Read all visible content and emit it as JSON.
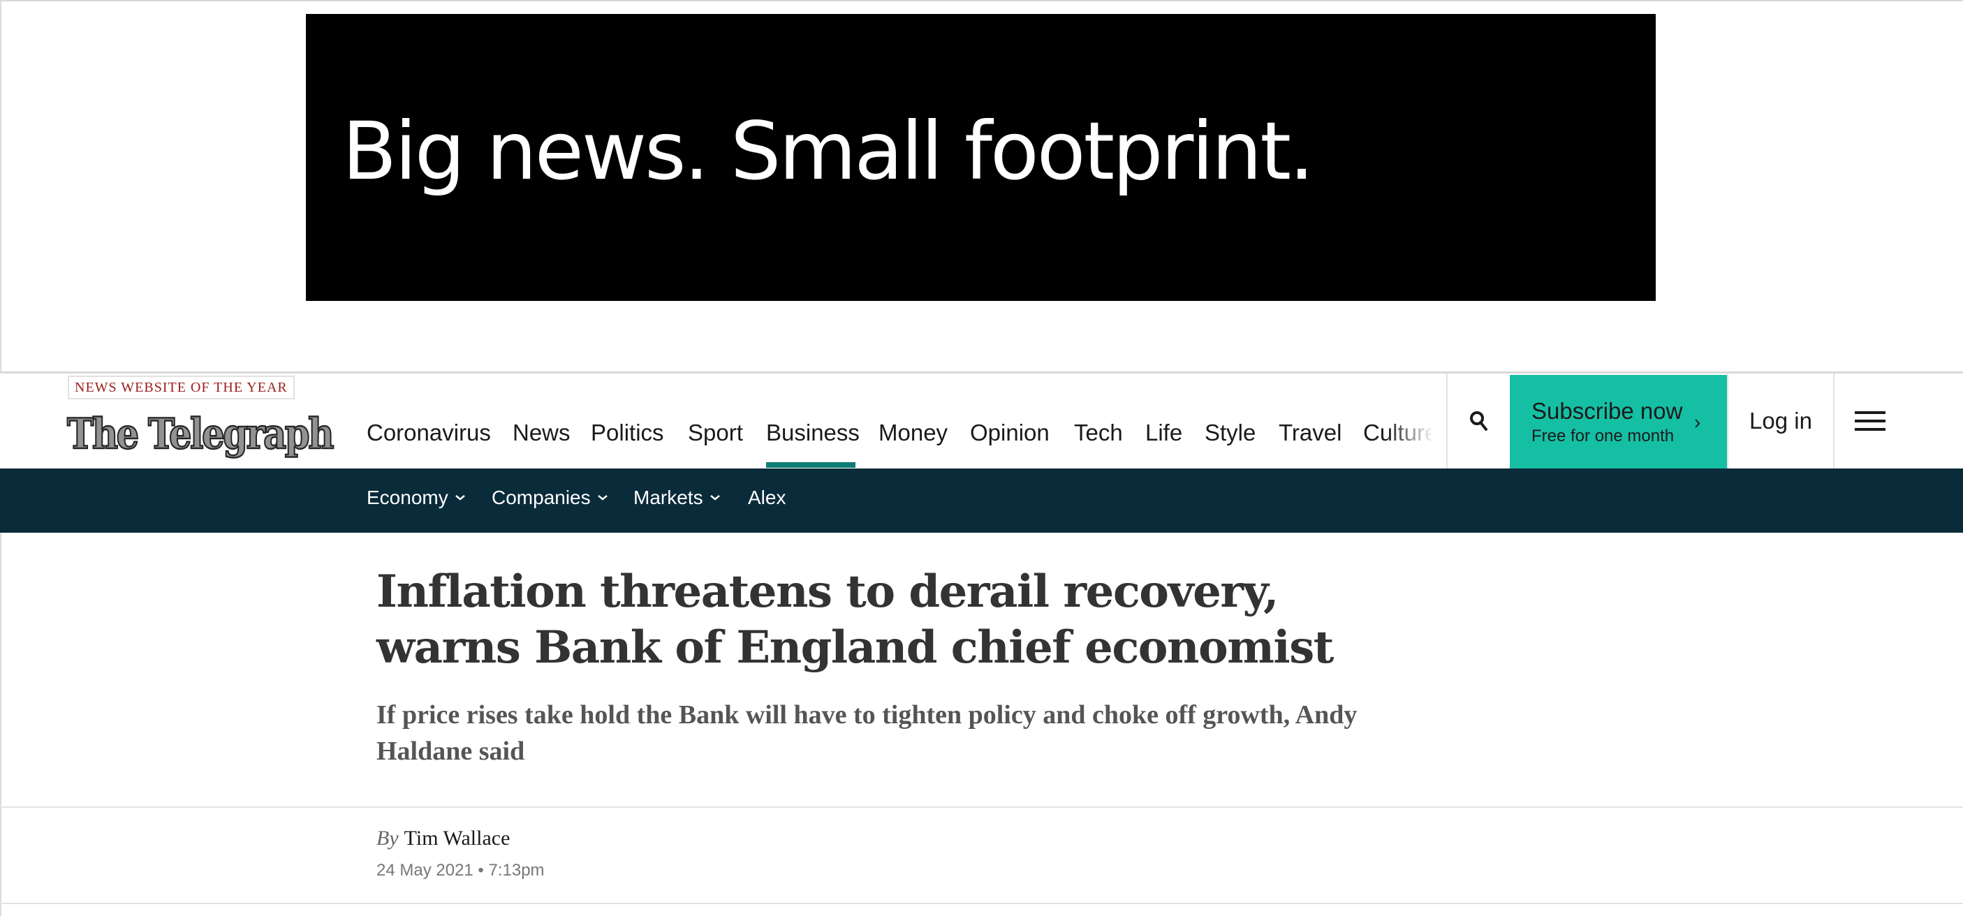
{
  "advert": {
    "headline": "Big news. Small footprint."
  },
  "header": {
    "award_badge": "NEWS WEBSITE OF THE YEAR",
    "logo_text": "The Telegraph",
    "nav_items": [
      "Coronavirus",
      "News",
      "Politics",
      "Sport",
      "Business",
      "Money",
      "Opinion",
      "Tech",
      "Life",
      "Style",
      "Travel",
      "Culture"
    ],
    "active_item": "Business",
    "subscribe": {
      "label": "Subscribe now",
      "sublabel": "Free for one month"
    },
    "login_label": "Log in",
    "colors": {
      "accent": "#15bfa4",
      "active_underline": "#0c7d74",
      "subnav_bg": "#0a2b3a"
    }
  },
  "subnav": {
    "items": [
      {
        "label": "Economy",
        "has_dropdown": true
      },
      {
        "label": "Companies",
        "has_dropdown": true
      },
      {
        "label": "Markets",
        "has_dropdown": true
      },
      {
        "label": "Alex",
        "has_dropdown": false
      }
    ]
  },
  "article": {
    "headline": "Inflation threatens to derail recovery, warns Bank of England chief economist",
    "standfirst": "If price rises take hold the Bank will have to tighten policy and choke off growth, Andy Haldane said",
    "byline_prefix": "By",
    "author": "Tim Wallace",
    "dateline": "24 May 2021 • 7:13pm"
  },
  "icons": [
    "search-icon",
    "chevron-right-icon",
    "hamburger-menu-icon",
    "chevron-down-icon"
  ]
}
